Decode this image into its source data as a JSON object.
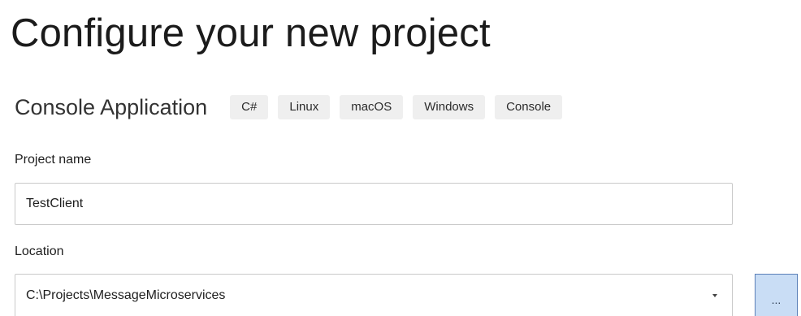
{
  "page": {
    "title": "Configure your new project"
  },
  "template": {
    "name": "Console Application",
    "tags": [
      "C#",
      "Linux",
      "macOS",
      "Windows",
      "Console"
    ]
  },
  "project_name": {
    "label": "Project name",
    "value": "TestClient"
  },
  "location": {
    "label": "Location",
    "value": "C:\\Projects\\MessageMicroservices",
    "dropdown_icon": "chevron-down-icon",
    "browse_label": "..."
  }
}
